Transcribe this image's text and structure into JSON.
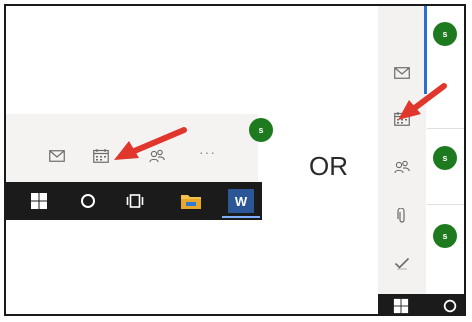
{
  "separator_text": "OR",
  "avatar_initial": "s",
  "colors": {
    "accent_blue": "#2b6fd6",
    "avatar_green": "#1e7a1e",
    "arrow_red": "#e0362c",
    "taskbar": "#1b1b1b",
    "rail": "#f3f2f1"
  },
  "left_variant": {
    "bar_icons": [
      "mail-icon",
      "calendar-icon",
      "people-icon",
      "more-icon"
    ],
    "more_label": "···",
    "taskbar_icons": [
      "windows-start-icon",
      "cortana-icon",
      "task-view-icon",
      "file-explorer-icon",
      "word-icon"
    ],
    "word_letter": "W"
  },
  "right_variant": {
    "rail_icons": [
      "mail-icon",
      "calendar-icon",
      "people-icon",
      "attachment-icon",
      "todo-icon"
    ],
    "taskbar_icons": [
      "windows-start-icon",
      "cortana-icon"
    ]
  }
}
